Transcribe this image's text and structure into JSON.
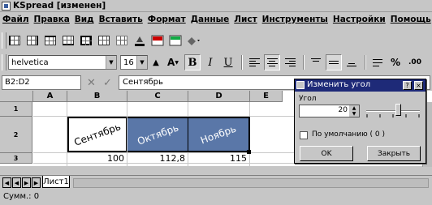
{
  "window": {
    "title": "KSpread [изменен]"
  },
  "menu": [
    "Файл",
    "Правка",
    "Вид",
    "Вставить",
    "Формат",
    "Данные",
    "Лист",
    "Инструменты",
    "Настройки",
    "Помощь"
  ],
  "toolbar": {
    "border_icons": [
      "border-left-icon",
      "border-right-icon",
      "border-top-icon",
      "border-bottom-icon",
      "border-all-icon",
      "border-outline-icon",
      "border-none-icon"
    ],
    "extra_icons": [
      "fill-color-icon",
      "cell-style-icon",
      "merge-icon"
    ]
  },
  "format_bar": {
    "font": "helvetica",
    "size": "16",
    "text_color_glyph": "A",
    "bold": "B",
    "italic": "I",
    "underline": "U",
    "percent": "%",
    "decimal": ".00"
  },
  "formula_bar": {
    "cell_ref": "B2:D2",
    "cancel": "✕",
    "confirm": "✓",
    "content": "Сентябрь"
  },
  "sheet": {
    "columns": [
      "A",
      "B",
      "C",
      "D",
      "E"
    ],
    "rows": [
      "1",
      "2",
      "3"
    ],
    "headers": [
      "Сентябрь",
      "Октябрь",
      "Ноябрь"
    ],
    "values": [
      "100",
      "112,8",
      "115"
    ]
  },
  "tabs": {
    "sheet_name": "Лист1"
  },
  "status": {
    "text": "Сумм.: 0"
  },
  "dialog": {
    "title": "Изменить угол",
    "help": "?",
    "close": "×",
    "label": "Угол",
    "angle_value": "20",
    "slider_level": 0.6,
    "checkbox_label": "По умолчанию ( 0 )",
    "checkbox_checked": false,
    "ok": "OK",
    "close_button": "Закрыть"
  },
  "colors": {
    "header_fill": "#5a77a8",
    "dialog_title": "#1e2a78"
  }
}
